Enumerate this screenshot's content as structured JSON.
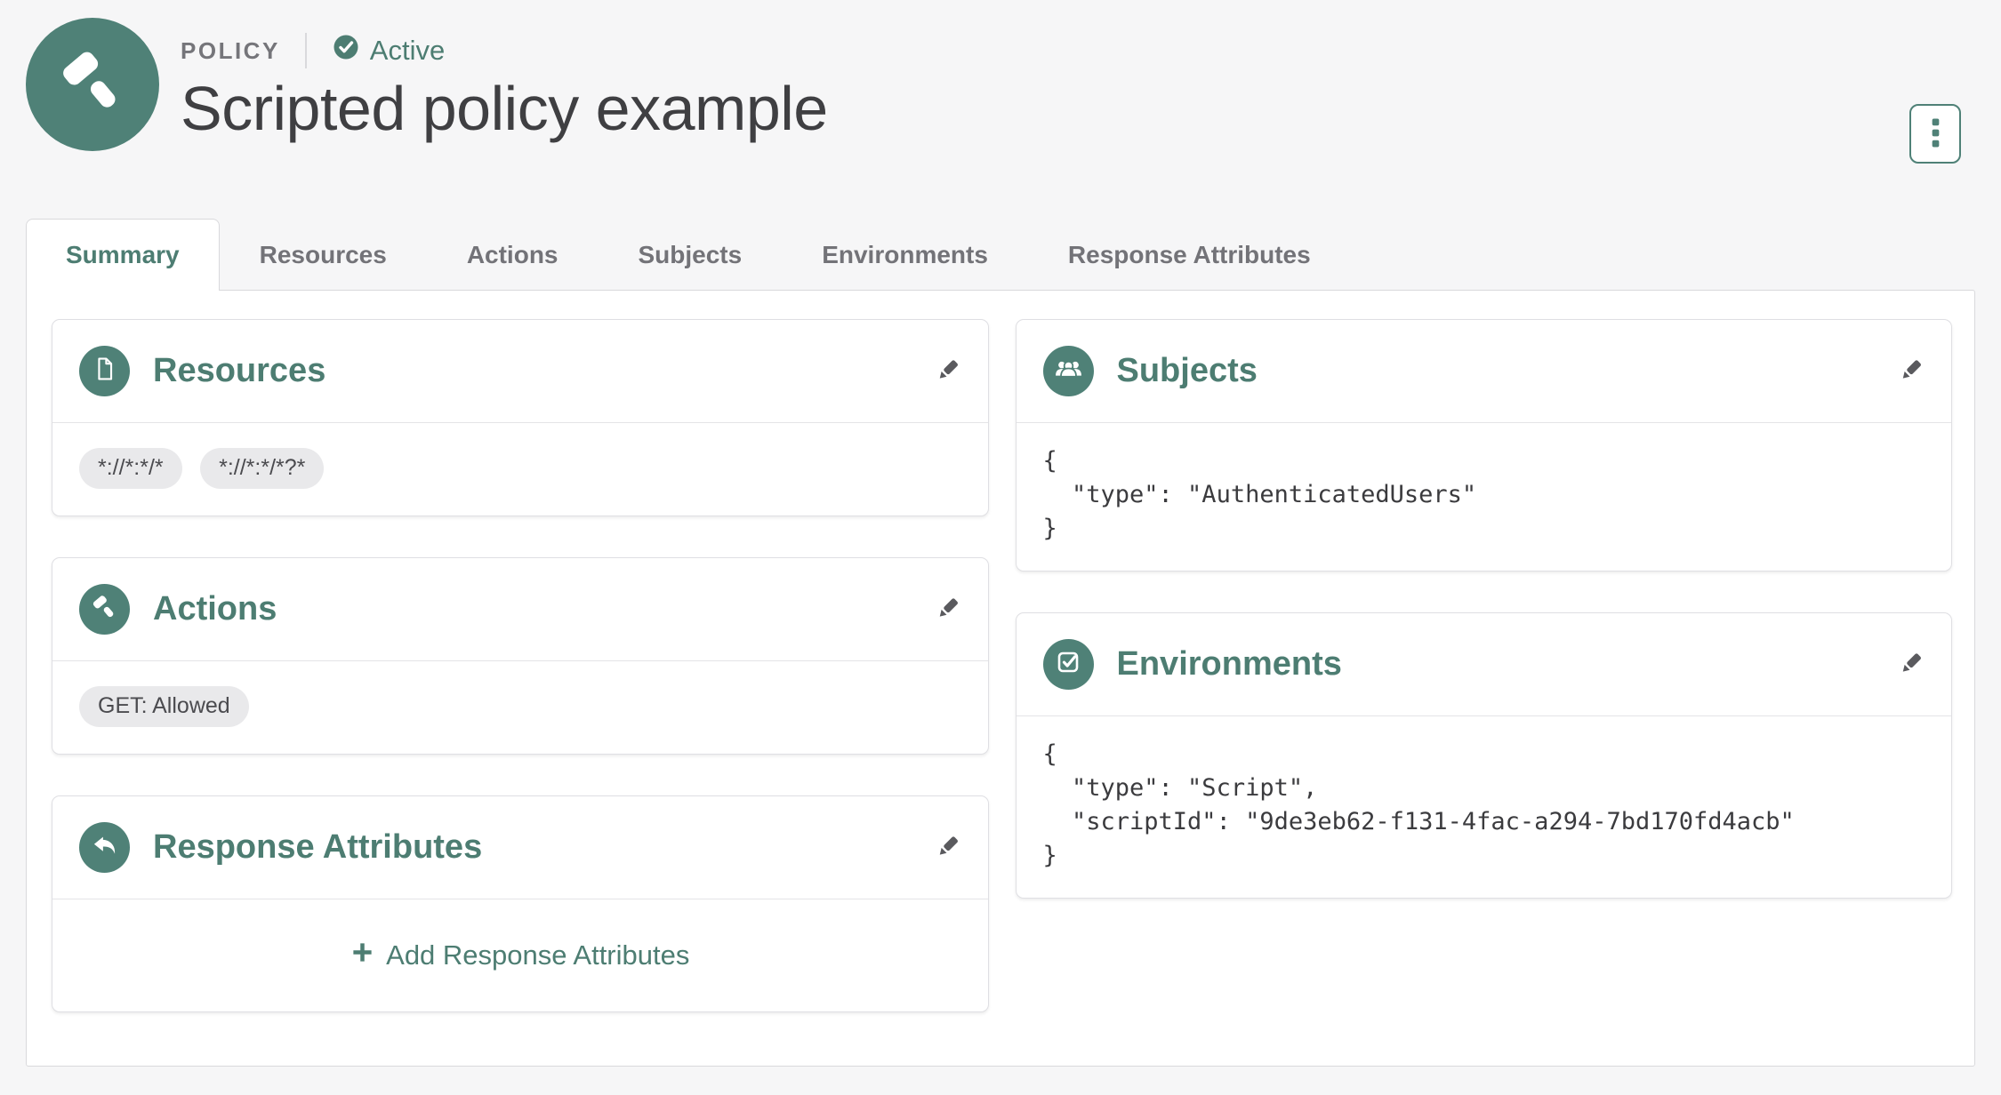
{
  "colors": {
    "accent": "#4f8177",
    "accent_text": "#4d7d72",
    "page_background": "#f6f6f7",
    "tag_background": "#e9e9eb"
  },
  "header": {
    "entity_type": "POLICY",
    "status_label": "Active",
    "status_icon": "check-circle-icon",
    "avatar_icon": "gavel-icon",
    "title": "Scripted policy example",
    "menu_icon": "kebab-vertical-icon"
  },
  "tabs": [
    {
      "label": "Summary",
      "active": true
    },
    {
      "label": "Resources",
      "active": false
    },
    {
      "label": "Actions",
      "active": false
    },
    {
      "label": "Subjects",
      "active": false
    },
    {
      "label": "Environments",
      "active": false
    },
    {
      "label": "Response Attributes",
      "active": false
    }
  ],
  "cards": {
    "resources": {
      "title": "Resources",
      "icon": "file-icon",
      "edit_icon": "pencil-icon",
      "tags": [
        "*://*:*/*",
        "*://*:*/*?*"
      ]
    },
    "actions": {
      "title": "Actions",
      "icon": "gavel-icon",
      "edit_icon": "pencil-icon",
      "tags": [
        "GET: Allowed"
      ]
    },
    "response_attributes": {
      "title": "Response Attributes",
      "icon": "reply-arrow-icon",
      "edit_icon": "pencil-icon",
      "add_icon": "plus-icon",
      "add_label": "Add Response Attributes"
    },
    "subjects": {
      "title": "Subjects",
      "icon": "users-icon",
      "edit_icon": "pencil-icon",
      "json": "{\n  \"type\": \"AuthenticatedUsers\"\n}"
    },
    "environments": {
      "title": "Environments",
      "icon": "checkbox-check-icon",
      "edit_icon": "pencil-icon",
      "json": "{\n  \"type\": \"Script\",\n  \"scriptId\": \"9de3eb62-f131-4fac-a294-7bd170fd4acb\"\n}"
    }
  }
}
